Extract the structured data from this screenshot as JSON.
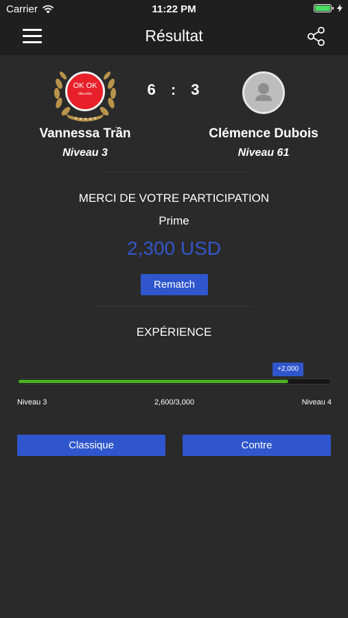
{
  "status_bar": {
    "carrier": "Carrier",
    "time": "11:22 PM"
  },
  "nav": {
    "title": "Résultat",
    "menu_icon": "hamburger-menu-icon",
    "share_icon": "share-icon"
  },
  "player_left": {
    "name": "Vannessa Trần",
    "level": "Niveau 3",
    "badge_line1": "OK OK",
    "badge_line2": "ttiks.mifu"
  },
  "player_right": {
    "name": "Clémence Dubois",
    "level": "Niveau 61",
    "avatar_icon": "user-placeholder-icon"
  },
  "score": {
    "left": "6",
    "sep": ":",
    "right": "3"
  },
  "reward": {
    "thanks": "MERCI DE VOTRE PARTICIPATION",
    "prize_label": "Prime",
    "prize_amount": "2,300 USD",
    "rematch_label": "Rematch"
  },
  "experience": {
    "title": "EXPÉRIENCE",
    "gain": "+2,000",
    "progress_value": 2600,
    "progress_max": 3000,
    "progress_text": "2,600/3,000",
    "from_level": "Niveau 3",
    "to_level": "Niveau 4"
  },
  "modes": {
    "classic_label": "Classique",
    "versus_label": "Contre"
  },
  "colors": {
    "accent_blue": "#2f56cc",
    "amount_blue": "#3356c9",
    "progress_green": "#4caf24",
    "badge_red": "#e8202a"
  }
}
